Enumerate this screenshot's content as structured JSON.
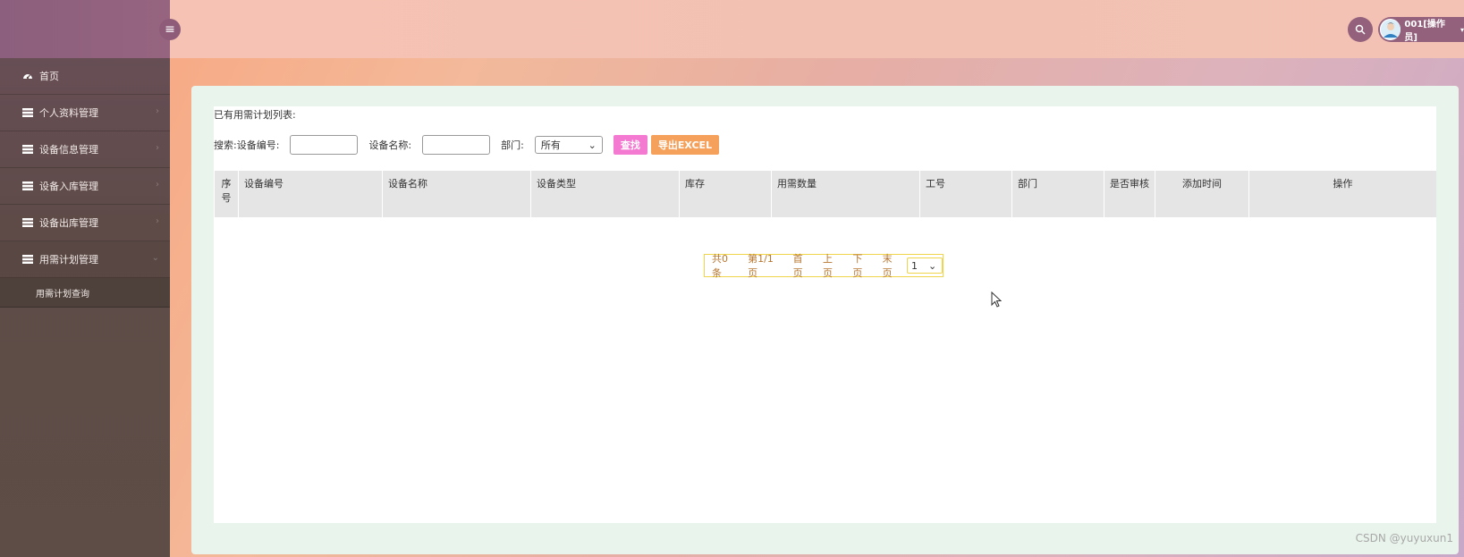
{
  "header": {
    "user_label": "001[操作员]"
  },
  "sidebar": {
    "items": [
      {
        "label": "首页",
        "icon": "dashboard-icon"
      },
      {
        "label": "个人资料管理",
        "icon": "list-icon"
      },
      {
        "label": "设备信息管理",
        "icon": "list-icon"
      },
      {
        "label": "设备入库管理",
        "icon": "list-icon"
      },
      {
        "label": "设备出库管理",
        "icon": "list-icon"
      },
      {
        "label": "用需计划管理",
        "icon": "list-icon"
      }
    ],
    "sub_items": [
      {
        "label": "用需计划查询"
      }
    ]
  },
  "main": {
    "title": "已有用需计划列表:",
    "search": {
      "label": "搜索:",
      "code_label": "设备编号:",
      "name_label": "设备名称:",
      "dept_label": "部门:",
      "dept_value": "所有",
      "find_label": "查找",
      "export_label": "导出EXCEL"
    },
    "table": {
      "headers": [
        "序号",
        "设备编号",
        "设备名称",
        "设备类型",
        "库存",
        "用需数量",
        "工号",
        "部门",
        "是否审核",
        "添加时间",
        "操作"
      ]
    },
    "pager": {
      "total": "共0条",
      "page": "第1/1页",
      "first": "首页",
      "prev": "上页",
      "next": "下页",
      "last": "末页",
      "current": "1"
    }
  },
  "watermark": "CSDN @yuyuxun1",
  "colors": {
    "sidebar": "#5e4b48",
    "header": "#f2c1b2",
    "find_button": "#f47ad1",
    "export_button": "#f5a15c",
    "pager_border": "#f0d54a"
  }
}
